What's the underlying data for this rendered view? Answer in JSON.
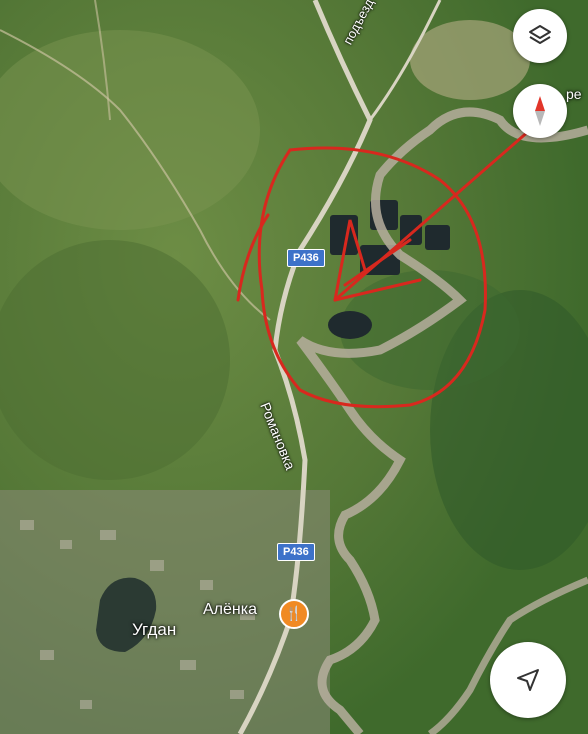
{
  "roads": {
    "access_road": "подъезд К Шишкино",
    "main_road": "Романовка",
    "route_shield_1": "Р436",
    "route_shield_2": "Р436"
  },
  "places": {
    "village": "Угдан",
    "edge_label": "ре"
  },
  "poi": {
    "name": "Алёнка",
    "icon": "restaurant-icon"
  },
  "controls": {
    "layers_icon": "layers-icon",
    "compass_icon": "compass-icon",
    "navigate_icon": "navigation-arrow-icon"
  },
  "colors": {
    "annotation": "#d8281e",
    "route_shield": "#3d72c9",
    "poi": "#f08a24"
  }
}
